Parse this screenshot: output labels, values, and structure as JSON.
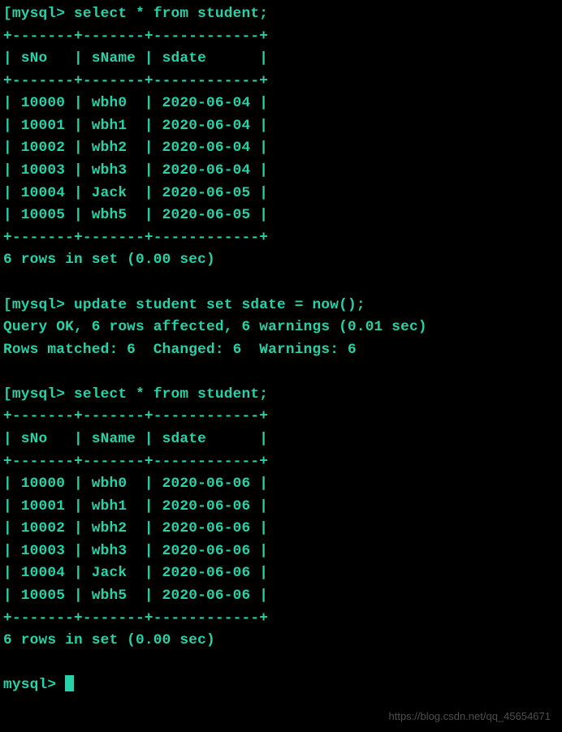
{
  "prompt_bracket_open": "[",
  "prompt": "mysql>",
  "query1": " select * from student;",
  "table_border": "+-------+-------+------------+",
  "table_header": "| sNo   | sName | sdate      |",
  "table1_rows": [
    "| 10000 | wbh0  | 2020-06-04 |",
    "| 10001 | wbh1  | 2020-06-04 |",
    "| 10002 | wbh2  | 2020-06-04 |",
    "| 10003 | wbh3  | 2020-06-04 |",
    "| 10004 | Jack  | 2020-06-05 |",
    "| 10005 | wbh5  | 2020-06-05 |"
  ],
  "result1": "6 rows in set (0.00 sec)",
  "query2": " update student set sdate = now();",
  "update_result1": "Query OK, 6 rows affected, 6 warnings (0.01 sec)",
  "update_result2": "Rows matched: 6  Changed: 6  Warnings: 6",
  "query3": " select * from student;",
  "table2_rows": [
    "| 10000 | wbh0  | 2020-06-06 |",
    "| 10001 | wbh1  | 2020-06-06 |",
    "| 10002 | wbh2  | 2020-06-06 |",
    "| 10003 | wbh3  | 2020-06-06 |",
    "| 10004 | Jack  | 2020-06-06 |",
    "| 10005 | wbh5  | 2020-06-06 |"
  ],
  "result2": "6 rows in set (0.00 sec)",
  "final_prompt": "mysql> ",
  "watermark": "https://blog.csdn.net/qq_45654671",
  "chart_data": {
    "type": "table",
    "columns": [
      "sNo",
      "sName",
      "sdate"
    ],
    "before_update": [
      {
        "sNo": 10000,
        "sName": "wbh0",
        "sdate": "2020-06-04"
      },
      {
        "sNo": 10001,
        "sName": "wbh1",
        "sdate": "2020-06-04"
      },
      {
        "sNo": 10002,
        "sName": "wbh2",
        "sdate": "2020-06-04"
      },
      {
        "sNo": 10003,
        "sName": "wbh3",
        "sdate": "2020-06-04"
      },
      {
        "sNo": 10004,
        "sName": "Jack",
        "sdate": "2020-06-05"
      },
      {
        "sNo": 10005,
        "sName": "wbh5",
        "sdate": "2020-06-05"
      }
    ],
    "after_update": [
      {
        "sNo": 10000,
        "sName": "wbh0",
        "sdate": "2020-06-06"
      },
      {
        "sNo": 10001,
        "sName": "wbh1",
        "sdate": "2020-06-06"
      },
      {
        "sNo": 10002,
        "sName": "wbh2",
        "sdate": "2020-06-06"
      },
      {
        "sNo": 10003,
        "sName": "wbh3",
        "sdate": "2020-06-06"
      },
      {
        "sNo": 10004,
        "sName": "Jack",
        "sdate": "2020-06-06"
      },
      {
        "sNo": 10005,
        "sName": "wbh5",
        "sdate": "2020-06-06"
      }
    ]
  }
}
